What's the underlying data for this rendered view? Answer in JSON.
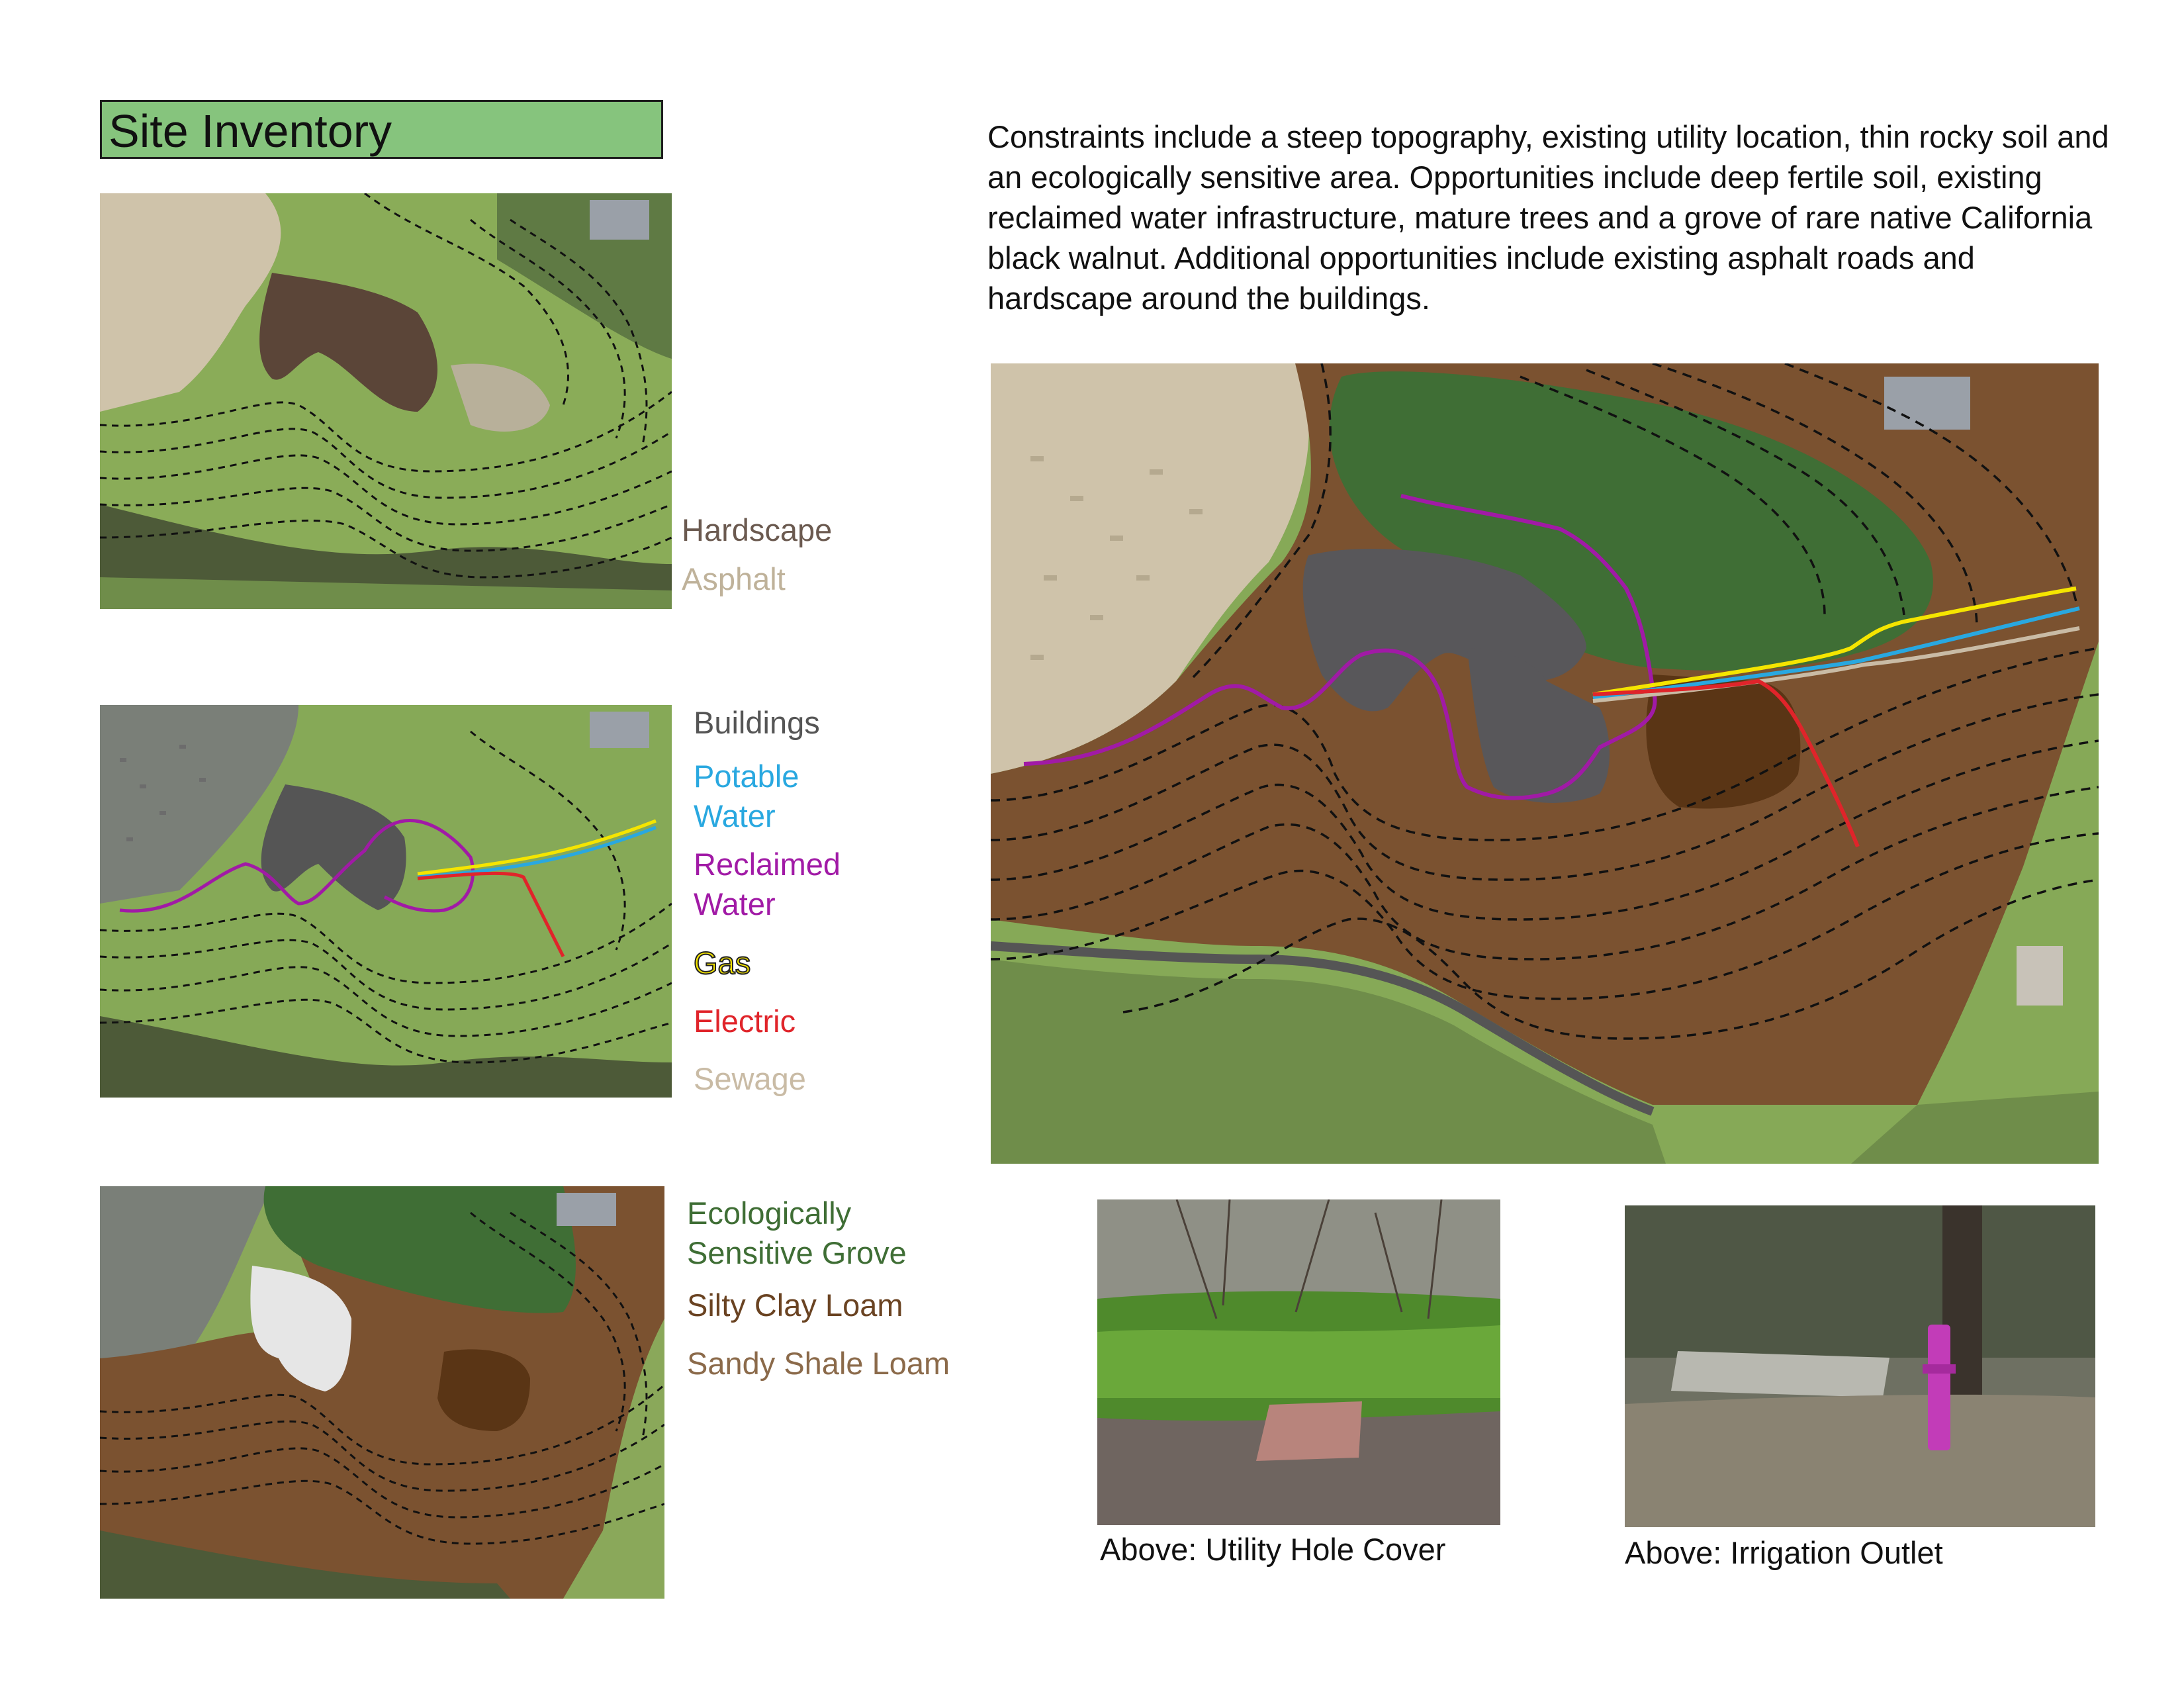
{
  "title": "Site Inventory",
  "intro": "Constraints include a steep topography, existing utility location, thin rocky soil and an ecologically sensitive area.  Opportunities include deep fertile soil, existing reclaimed water infrastructure, mature trees and a grove of rare native California black walnut.  Additional opportunities include existing asphalt roads and hardscape around the buildings.",
  "legend1": {
    "hardscape": {
      "label": "Hardscape",
      "color": "#6b5a50"
    },
    "asphalt": {
      "label": "Asphalt",
      "color": "#bfb29a"
    }
  },
  "legend2": {
    "buildings": {
      "label": "Buildings",
      "color": "#555555"
    },
    "potable_line1": "Potable",
    "potable_line2": "Water",
    "potable_color": "#29a8e0",
    "reclaimed_line1": "Reclaimed",
    "reclaimed_line2": "Water",
    "reclaimed_color": "#a11aa6",
    "gas": {
      "label": "Gas",
      "color": "#f5e500"
    },
    "electric": {
      "label": "Electric",
      "color": "#e0242a"
    },
    "sewage": {
      "label": "Sewage",
      "color": "#c9bba5"
    }
  },
  "legend3": {
    "grove_line1": "Ecologically",
    "grove_line2": "Sensitive Grove",
    "grove_color": "#3f6e35",
    "silty": {
      "label": "Silty Clay Loam",
      "color": "#6a4322"
    },
    "sandy": {
      "label": "Sandy Shale Loam",
      "color": "#8b6a4a"
    }
  },
  "captions": {
    "utility": "Above: Utility Hole Cover",
    "irrigation": "Above: Irrigation Outlet"
  }
}
